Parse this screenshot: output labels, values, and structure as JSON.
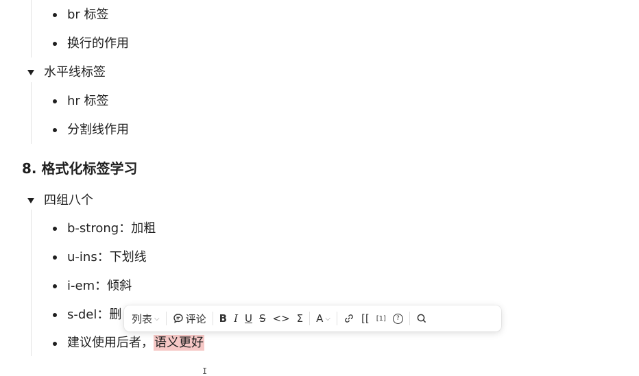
{
  "outline": {
    "line1": "br 标签",
    "line2": "换行的作用",
    "line3": "水平线标签",
    "line4": "hr 标签",
    "line5": "分割线作用",
    "heading": "8. 格式化标签学习",
    "line6": "四组八个",
    "line7": "b-strong：加粗",
    "line8": "u-ins：下划线",
    "line9": "i-em：倾斜",
    "line10": "s-del：删",
    "line11_plain": "建议使用后者，",
    "line11_highlight": "语义更好",
    "cursor_glyph": "I"
  },
  "toolbar": {
    "list_label": "列表",
    "list_chevron": "⌵",
    "comment_label": "评论",
    "bold": "B",
    "italic": "I",
    "underline": "U",
    "strike": "S",
    "code": "<>",
    "formula": "Σ",
    "text_color": "A",
    "text_color_chevron": "⌵",
    "link_icon": "link-icon",
    "wiki_link": "[[",
    "footnote": "[1]",
    "help": "?",
    "search_icon": "search-icon"
  },
  "colors": {
    "highlight": "#f6c8c6",
    "text": "#1f1f1f"
  }
}
